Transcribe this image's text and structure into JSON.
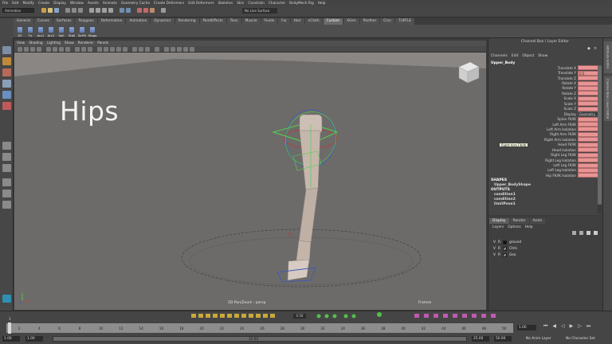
{
  "menu": [
    "File",
    "Edit",
    "Modify",
    "Create",
    "Display",
    "Window",
    "Assets",
    "Animate",
    "Geometry Cache",
    "Create Deformers",
    "Edit Deformers",
    "Skeleton",
    "Skin",
    "Constrain",
    "Character",
    "BodyMech Rig",
    "Help"
  ],
  "status": {
    "mode": "Animation",
    "live_surface": "No Live Surface"
  },
  "shelf": {
    "tabs": [
      "General",
      "Curves",
      "Surfaces",
      "Polygons",
      "Deformation",
      "Animation",
      "Dynamics",
      "Rendering",
      "PaintEffects",
      "Toon",
      "Muscle",
      "Fluids",
      "Fur",
      "Hair",
      "nCloth",
      "Custom",
      "XGen",
      "Panther",
      "Croc",
      "TURTLE"
    ],
    "active_tab": "Custom",
    "buttons": [
      "ZV",
      "Fx",
      "Arc1",
      "Arc2",
      "Sell",
      "Stall",
      "SelFk",
      "Stage"
    ]
  },
  "viewport": {
    "menu": [
      "View",
      "Shading",
      "Lighting",
      "Show",
      "Renderer",
      "Panels"
    ],
    "overlay_text": "Hips",
    "camera_label": "2D Pan/Zoom : persp",
    "frames_label": "Frames"
  },
  "channel_box": {
    "title": "Channel Box / Layer Editor",
    "menu": [
      "Channels",
      "Edit",
      "Object",
      "Show"
    ],
    "object_name": "Upper_Body",
    "attributes": [
      {
        "name": "Translate X",
        "value": ""
      },
      {
        "name": "Translate Y",
        "value": "0.5"
      },
      {
        "name": "Translate Z",
        "value": ""
      },
      {
        "name": "Rotate X",
        "value": ""
      },
      {
        "name": "Rotate Y",
        "value": ""
      },
      {
        "name": "Rotate Z",
        "value": ""
      },
      {
        "name": "Scale X",
        "value": ""
      },
      {
        "name": "Scale Y",
        "value": ""
      },
      {
        "name": "Scale Z",
        "value": ""
      },
      {
        "name": "Display",
        "value": "Geometry"
      },
      {
        "name": "Spine FK/IK",
        "value": ""
      },
      {
        "name": "Left Arm FK/IK",
        "value": ""
      },
      {
        "name": "Left Arm Isolation",
        "value": ""
      },
      {
        "name": "Right Arm FK/IK",
        "value": ""
      },
      {
        "name": "Right Arm Isolation",
        "value": ""
      },
      {
        "name": "Head FK/IK",
        "value": ""
      },
      {
        "name": "Head Isolation",
        "value": ""
      },
      {
        "name": "Right Leg FK/IK",
        "value": ""
      },
      {
        "name": "Right Leg Isolation",
        "value": ""
      },
      {
        "name": "Left Leg FK/IK",
        "value": ""
      },
      {
        "name": "Left Leg Isolation",
        "value": ""
      },
      {
        "name": "Hip FK/IK Isolation",
        "value": ""
      }
    ],
    "tooltip": "Right Arm FK/IK",
    "shapes_header": "SHAPES",
    "shape_name": "Upper_BodyShape",
    "outputs_header": "OUTPUTS",
    "outputs": [
      "condition1",
      "condition2",
      "limitPose1"
    ]
  },
  "layer_editor": {
    "tabs": [
      "Display",
      "Render",
      "Anim"
    ],
    "active_tab": "Display",
    "menu": [
      "Layers",
      "Options",
      "Help"
    ],
    "layers": [
      {
        "v": "V",
        "p": "R",
        "name": "ground"
      },
      {
        "v": "V",
        "p": "R",
        "name": "Ctrls"
      },
      {
        "v": "V",
        "p": "R",
        "name": "Geo"
      }
    ]
  },
  "side_tabs": [
    "Attribute Editor",
    "Channel Box / Layer Editor"
  ],
  "timeline": {
    "value_field": "0.50",
    "current_frame": "1",
    "end_field": "1.00",
    "ticks": [
      "1",
      "2",
      "4",
      "6",
      "8",
      "10",
      "12",
      "14",
      "16",
      "18",
      "20",
      "22",
      "24",
      "26",
      "28",
      "30",
      "32",
      "34",
      "36",
      "38",
      "40",
      "42",
      "44",
      "46",
      "48",
      "50"
    ]
  },
  "range": {
    "start": "1.00",
    "start2": "1.00",
    "bar_label": "25.00",
    "end": "25.00",
    "end2": "50.00",
    "anim_layer": "No Anim Layer",
    "character_set": "No Character Set"
  },
  "colors": {
    "keyed_attr": "#e99494",
    "viewport_bg": "#6d6b69",
    "accent_green": "#52d24e"
  }
}
